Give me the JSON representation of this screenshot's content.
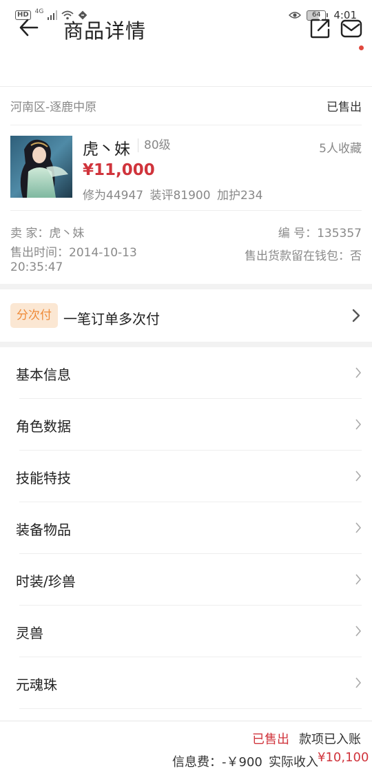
{
  "status_bar": {
    "network_badge": "HD",
    "network_type": "4G",
    "battery_level": "64",
    "time": "4:01"
  },
  "header": {
    "title": "商品详情",
    "icons": [
      "back-arrow-icon",
      "share-icon",
      "mail-icon"
    ],
    "notification_dot_color": "#e0483e"
  },
  "server": {
    "name": "河南区-逐鹿中原",
    "status": "已售出"
  },
  "product": {
    "name": "虎丶妹",
    "level": "80级",
    "favorites": "5人收藏",
    "price": "¥11,000",
    "stats": "修为44947 装评81900 加护234"
  },
  "seller": {
    "seller_text": "卖  家：虎丶妹",
    "serial_text": "编  号：135357",
    "sold_time_text": "售出时间：2014-10-13 20:35:47",
    "wallet_text": "售出货款留在钱包：否"
  },
  "installment": {
    "badge": "分次付",
    "text": "一笔订单多次付"
  },
  "menu": {
    "items": [
      "基本信息",
      "角色数据",
      "技能特技",
      "装备物品",
      "时装/珍兽",
      "灵兽",
      "元魂珠"
    ]
  },
  "footer": {
    "sold": "已售出",
    "paid": "款项已入账",
    "fee": "信息费：-￥900",
    "income_label": "实际收入",
    "income": "¥10,100"
  },
  "colors": {
    "accent_red": "#d0343c",
    "badge_bg": "#fbe7d3",
    "badge_text": "#ef8a38"
  }
}
